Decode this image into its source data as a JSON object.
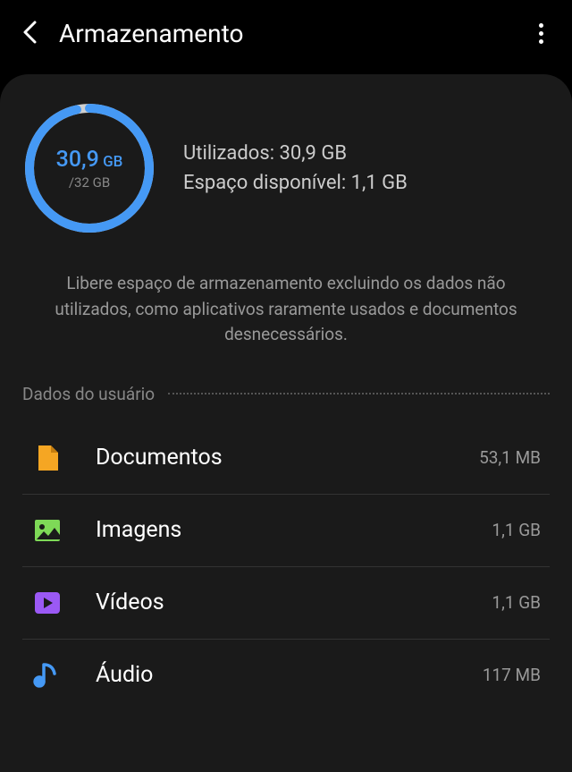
{
  "header": {
    "title": "Armazenamento"
  },
  "storage": {
    "used_value": "30,9",
    "used_unit": "GB",
    "total": "/32 GB",
    "used_label": "Utilizados: 30,9 GB",
    "available_label": "Espaço disponível: 1,1 GB",
    "percent_used": 96.6
  },
  "description": "Libere espaço de armazenamento excluindo os dados não utilizados, como aplicativos raramente usados e documentos desnecessários.",
  "section_title": "Dados do usuário",
  "items": [
    {
      "label": "Documentos",
      "size": "53,1 MB",
      "icon": "document",
      "color": "#f5a623"
    },
    {
      "label": "Imagens",
      "size": "1,1 GB",
      "icon": "image",
      "color": "#7ed957"
    },
    {
      "label": "Vídeos",
      "size": "1,1 GB",
      "icon": "video",
      "color": "#9b59f5"
    },
    {
      "label": "Áudio",
      "size": "117 MB",
      "icon": "audio",
      "color": "#4599f5"
    }
  ]
}
